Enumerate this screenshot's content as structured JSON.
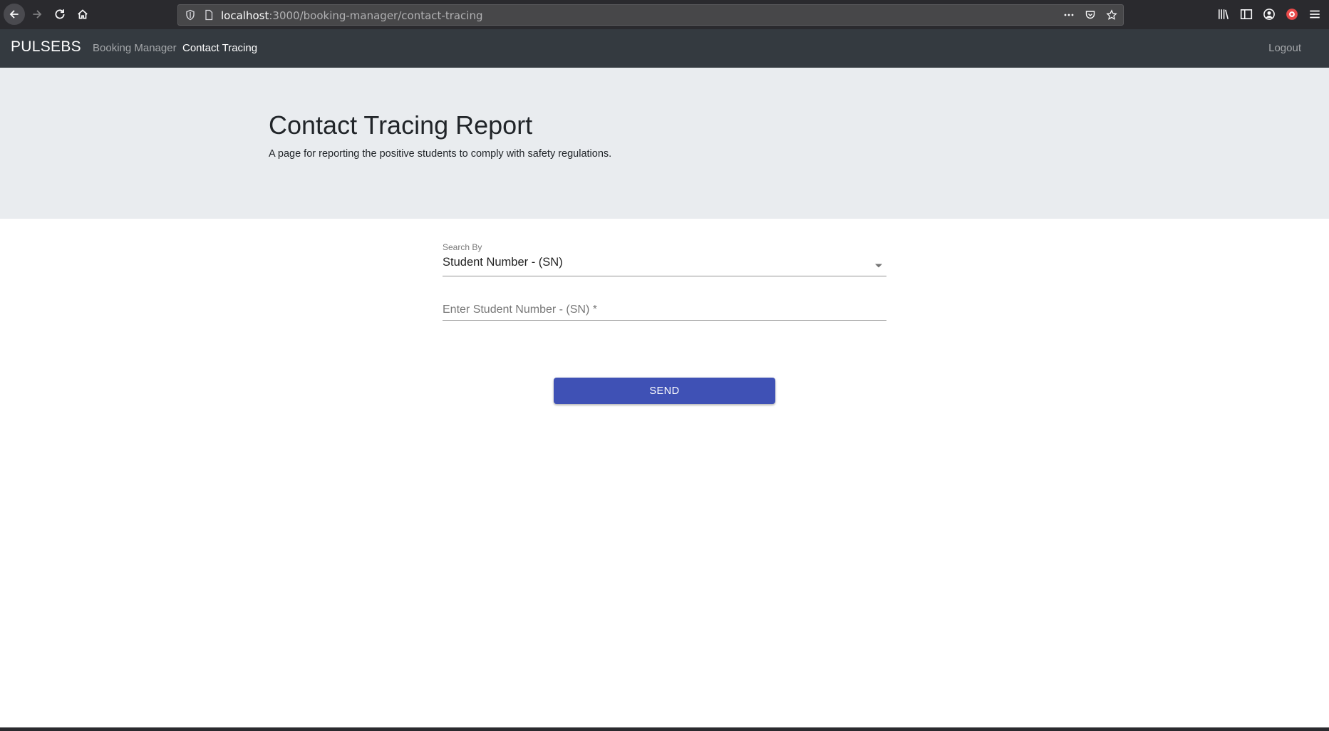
{
  "browser": {
    "url_host": "localhost",
    "url_path": ":3000/booking-manager/contact-tracing",
    "icons": {
      "back": "arrow-left",
      "forward": "arrow-right",
      "reload": "reload",
      "home": "home",
      "shield": "shield",
      "page": "page",
      "more": "ellipsis",
      "pocket": "pocket",
      "bookmark": "star",
      "library": "library",
      "sidebar": "sidebar",
      "account": "account",
      "extension": "extension",
      "menu": "hamburger"
    }
  },
  "navbar": {
    "brand": "PULSEBS",
    "links": [
      {
        "label": "Booking Manager",
        "active": false
      },
      {
        "label": "Contact Tracing",
        "active": true
      }
    ],
    "logout_label": "Logout"
  },
  "header": {
    "title": "Contact Tracing Report",
    "subtitle": "A page for reporting the positive students to comply with safety regulations."
  },
  "form": {
    "search_by_label": "Search By",
    "search_by_value": "Student Number - (SN)",
    "input_placeholder": "Enter Student Number - (SN) *",
    "input_value": "",
    "send_label": "SEND"
  },
  "colors": {
    "navbar_bg": "#343a40",
    "jumbotron_bg": "#e9ecef",
    "primary_button": "#3f51b5"
  }
}
